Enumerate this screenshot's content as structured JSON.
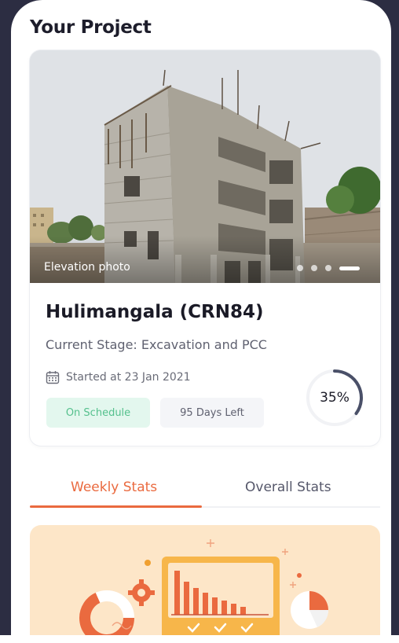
{
  "section": {
    "title": "Your Project"
  },
  "project": {
    "photo_label": "Elevation photo",
    "carousel": {
      "total": 4,
      "active_index": 3
    },
    "name": "Hulimangala (CRN84)",
    "stage": "Current Stage: Excavation and PCC",
    "started": "Started at 23 Jan 2021",
    "status_badge": "On Schedule",
    "days_left": "95 Days Left",
    "progress_text": "35%",
    "progress_value": 0.35
  },
  "tabs": [
    {
      "label": "Weekly Stats",
      "active": true
    },
    {
      "label": "Overall Stats",
      "active": false
    }
  ],
  "icons": {
    "calendar": "calendar-icon",
    "illustration": "stats-illustration"
  },
  "colors": {
    "accent": "#ea6a3f",
    "on_schedule_bg": "#e3f7ee",
    "on_schedule_text": "#55c08d",
    "progress_arc": "#4a5068",
    "bezel": "#2c2d42",
    "illustration_bg": "#fde6c8"
  }
}
